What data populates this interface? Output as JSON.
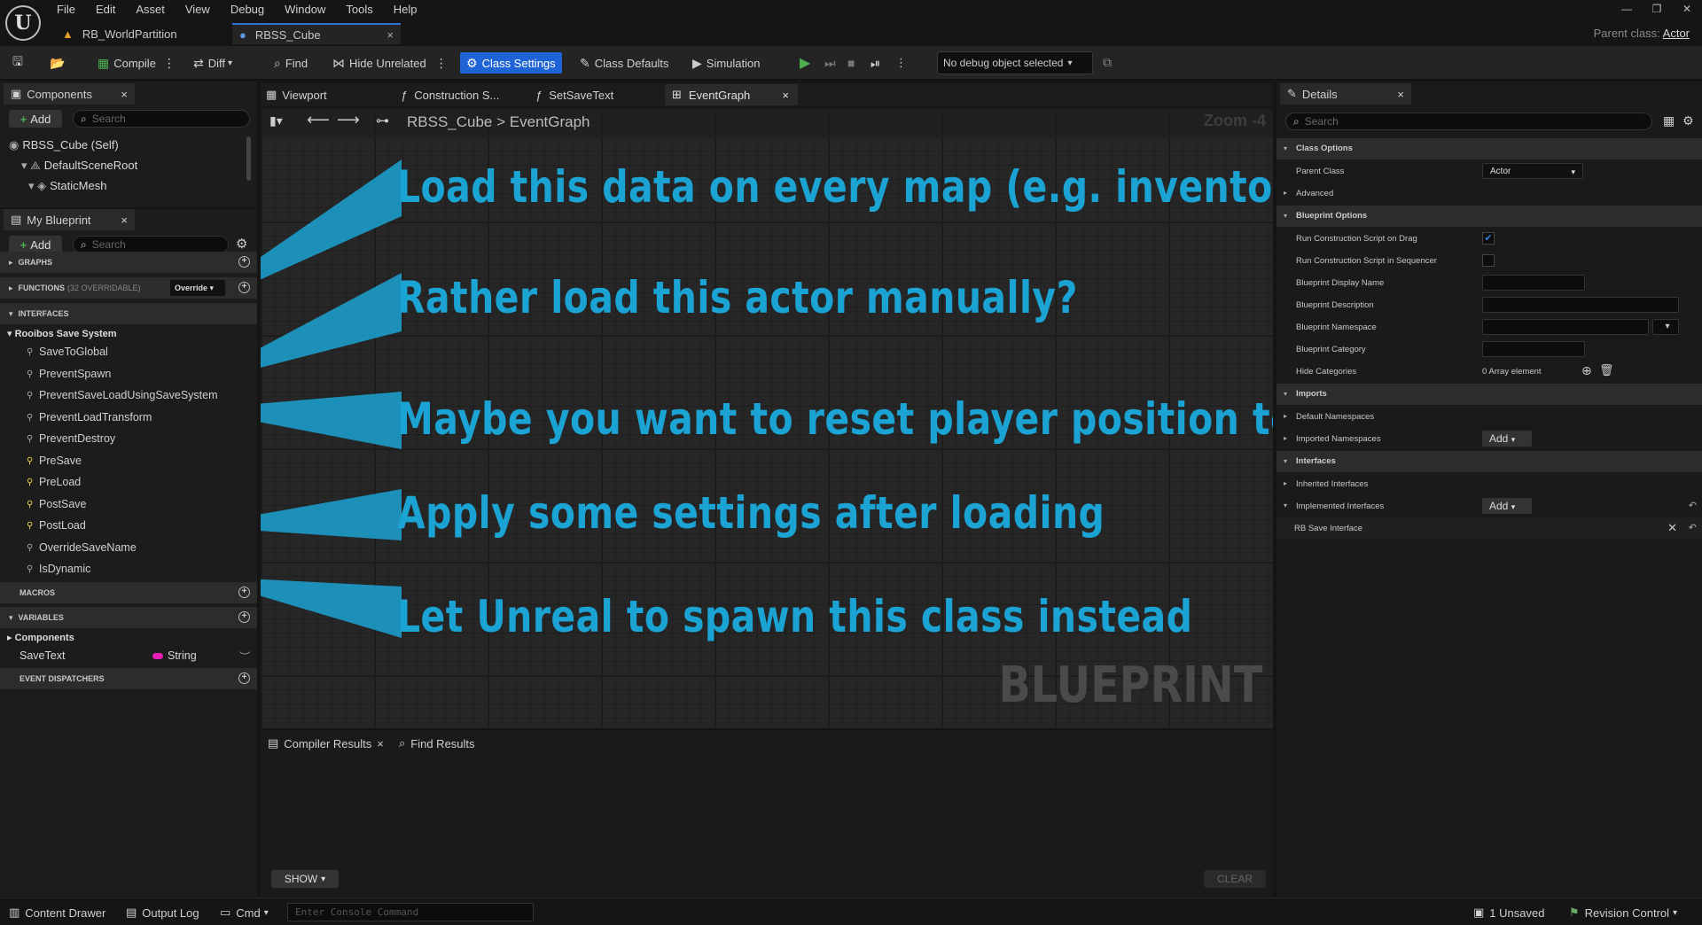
{
  "menu": [
    "File",
    "Edit",
    "Asset",
    "View",
    "Debug",
    "Window",
    "Tools",
    "Help"
  ],
  "doc_tabs": [
    {
      "label": "RB_WorldPartition",
      "active": false
    },
    {
      "label": "RBSS_Cube",
      "active": true
    }
  ],
  "parent_class": {
    "prefix": "Parent class:",
    "value": "Actor"
  },
  "toolbar": {
    "compile": "Compile",
    "diff": "Diff",
    "find": "Find",
    "hide_unrelated": "Hide Unrelated",
    "class_settings": "Class Settings",
    "class_defaults": "Class Defaults",
    "simulation": "Simulation",
    "debug_object": "No debug object selected"
  },
  "components": {
    "tab": "Components",
    "add": "Add",
    "search_placeholder": "Search",
    "tree": [
      "RBSS_Cube (Self)",
      "DefaultSceneRoot",
      "StaticMesh"
    ]
  },
  "my_blueprint": {
    "tab": "My Blueprint",
    "add": "Add",
    "search_placeholder": "Search",
    "graphs": "GRAPHS",
    "functions": "FUNCTIONS",
    "functions_count": "(32 OVERRIDABLE)",
    "override": "Override",
    "interfaces": "INTERFACES",
    "interface_group": "Rooibos Save System",
    "interface_functions": [
      "SaveToGlobal",
      "PreventSpawn",
      "PreventSaveLoadUsingSaveSystem",
      "PreventLoadTransform",
      "PreventDestroy",
      "PreSave",
      "PreLoad",
      "PostSave",
      "PostLoad",
      "OverrideSaveName",
      "IsDynamic"
    ],
    "macros": "MACROS",
    "variables": "VARIABLES",
    "var_group": "Components",
    "var_name": "SaveText",
    "var_type": "String",
    "event_dispatchers": "EVENT DISPATCHERS"
  },
  "graph_tabs": [
    "Viewport",
    "Construction S...",
    "SetSaveText",
    "EventGraph"
  ],
  "breadcrumb": {
    "root": "RBSS_Cube",
    "sep": ">",
    "leaf": "EventGraph"
  },
  "zoom": "Zoom -4",
  "callouts": [
    "Load this data on every map (e.g. inventory)",
    "Rather load this actor manually?",
    "Maybe you want to reset player position to...",
    "Apply some settings after loading",
    "Let Unreal to spawn this class instead"
  ],
  "watermark": "BLUEPRINT",
  "bottom_tabs": {
    "compiler": "Compiler Results",
    "find": "Find Results",
    "show": "SHOW",
    "clear": "CLEAR"
  },
  "details": {
    "tab": "Details",
    "search_placeholder": "Search",
    "class_options": "Class Options",
    "parent_class_label": "Parent Class",
    "parent_class_value": "Actor",
    "advanced": "Advanced",
    "blueprint_options": "Blueprint Options",
    "run_cs_drag": "Run Construction Script on Drag",
    "run_cs_sequencer": "Run Construction Script in Sequencer",
    "bp_display_name": "Blueprint Display Name",
    "bp_description": "Blueprint Description",
    "bp_namespace": "Blueprint Namespace",
    "bp_category": "Blueprint Category",
    "hide_categories": "Hide Categories",
    "array_element": "0 Array element",
    "imports": "Imports",
    "default_namespaces": "Default Namespaces",
    "imported_namespaces": "Imported Namespaces",
    "add": "Add",
    "interfaces": "Interfaces",
    "inherited_interfaces": "Inherited Interfaces",
    "implemented_interfaces": "Implemented Interfaces",
    "rb_save_interface": "RB Save Interface"
  },
  "statusbar": {
    "content_drawer": "Content Drawer",
    "output_log": "Output Log",
    "cmd": "Cmd",
    "console_placeholder": "Enter Console Command",
    "unsaved": "1 Unsaved",
    "revision_control": "Revision Control"
  },
  "colors": {
    "accent": "#1f64d6",
    "callout": "#1ba3d4",
    "string_pin": "#e91eb4"
  }
}
